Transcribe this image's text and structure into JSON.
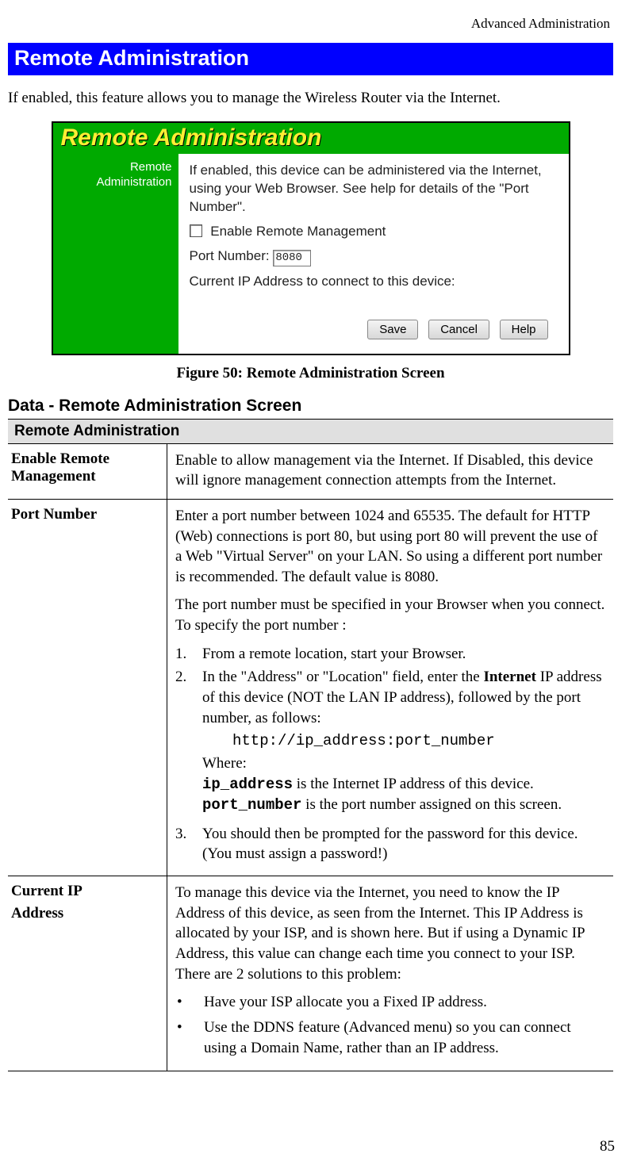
{
  "header": {
    "right": "Advanced Administration"
  },
  "title_bar": "Remote Administration",
  "intro": "If enabled, this feature allows you to manage the Wireless Router via the Internet.",
  "screenshot": {
    "title": "Remote Administration",
    "sidebar_l1": "Remote",
    "sidebar_l2": "Administration",
    "desc": "If enabled, this device can be administered via the Internet, using your Web Browser. See help for details of the \"Port Number\".",
    "checkbox_label": "Enable Remote Management",
    "port_label": "Port Number:",
    "port_value": "8080",
    "current_ip": "Current IP Address to connect to this device:",
    "buttons": {
      "save": "Save",
      "cancel": "Cancel",
      "help": "Help"
    }
  },
  "figure_caption": "Figure 50: Remote Administration Screen",
  "subheading": "Data - Remote Administration Screen",
  "table": {
    "section_header": "Remote Administration",
    "rows": {
      "enable": {
        "label": "Enable Remote Management",
        "desc": "Enable to allow management via the Internet. If Disabled, this device will ignore management connection attempts from the Internet."
      },
      "port": {
        "label": "Port Number",
        "p1": "Enter a port number between 1024 and 65535. The default for HTTP (Web) connections is port 80, but using port 80 will prevent the use of a Web \"Virtual Server\" on your LAN. So using a different port number is recommended. The default value is 8080.",
        "p2": "The port number must be specified in your Browser when you connect. To specify the port number :",
        "li1": "From a remote location, start your Browser.",
        "li2a": "In the \"Address\" or \"Location\" field, enter the ",
        "li2b_bold": "Internet",
        "li2c": " IP address of this device (NOT the LAN IP address), followed by the port number, as follows:",
        "code": "http://ip_address:port_number",
        "where_label": "Where:",
        "where1_code": "ip_address",
        "where1_rest": " is the Internet IP address of this device.",
        "where2_code": "port_number",
        "where2_rest": " is the port number assigned on this screen.",
        "li3": "You should then be prompted for the password for this device. (You must assign a password!)",
        "n1": "1.",
        "n2": "2.",
        "n3": "3."
      },
      "ip": {
        "label_l1": "Current IP",
        "label_l2": "Address",
        "p1": "To manage this device via the Internet, you need to know the IP Address of this device, as seen from the Internet. This IP Address is allocated by your ISP, and is shown here. But if using a Dynamic IP Address, this value can change each time you connect to your ISP. There are 2 solutions to this problem:",
        "b1": "Have your ISP allocate you a Fixed IP address.",
        "b2": "Use the DDNS feature (Advanced menu) so you can connect using a Domain Name, rather than an IP address."
      }
    }
  },
  "page_number": "85",
  "glyphs": {
    "bullet": "•"
  }
}
